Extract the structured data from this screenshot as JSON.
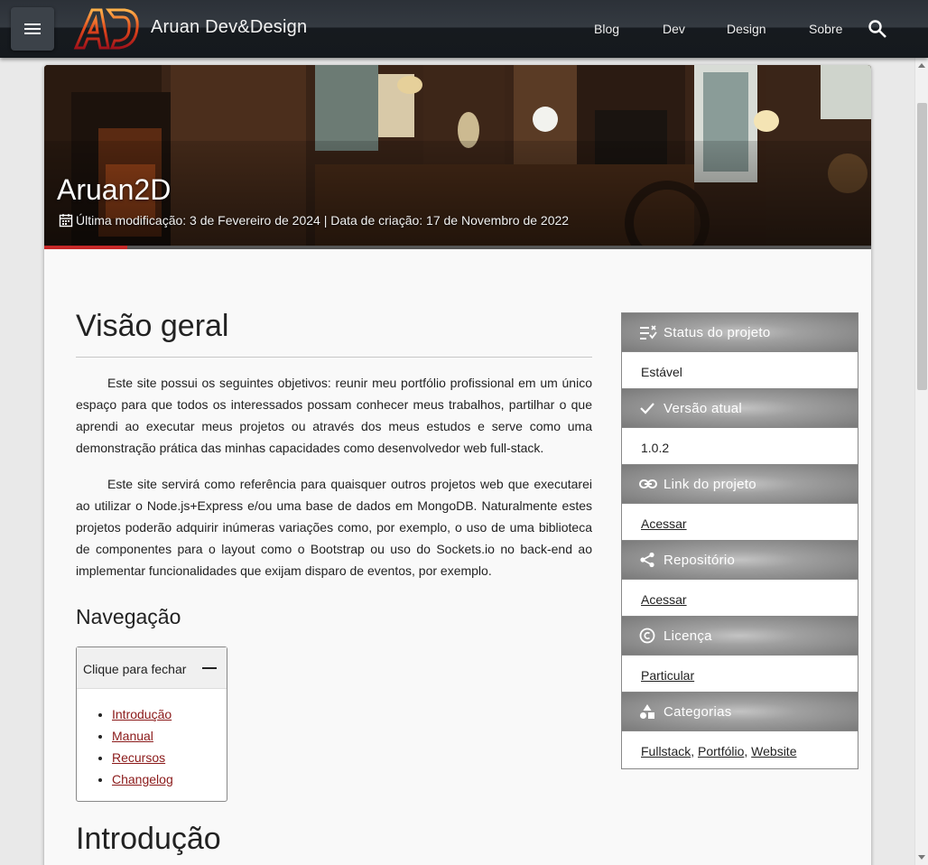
{
  "header": {
    "site_title": "Aruan Dev&Design",
    "logo_text": "AD",
    "nav": [
      "Blog",
      "Dev",
      "Design",
      "Sobre"
    ]
  },
  "hero": {
    "title": "Aruan2D",
    "meta": "Última modificação: 3 de Fevereiro de 2024 | Data de criação: 17 de Novembro de 2022",
    "progress_fraction": 0.1
  },
  "main": {
    "heading": "Visão geral",
    "paragraphs": [
      "Este site possui os seguintes objetivos: reunir meu portfólio profissional em um único espaço para que todos os interessados possam conhecer meus trabalhos, partilhar o que aprendi ao executar meus projetos ou através dos meus estudos e serve como uma demonstração prática das minhas capacidades como desenvolvedor web full-stack.",
      "Este site servirá como referência para quaisquer outros projetos web que executarei ao utilizar o Node.js+Express e/ou uma base de dados em MongoDB. Naturalmente estes projetos poderão adquirir inúmeras variações como, por exemplo, o uso de uma biblioteca de componentes para o layout como o Bootstrap ou uso do Sockets.io no back-end ao implementar funcionalidades que exijam disparo de eventos, por exemplo."
    ],
    "nav_heading": "Navegação",
    "toc_toggle": "Clique para fechar",
    "toc_items": [
      "Introdução",
      "Manual",
      "Recursos",
      "Changelog"
    ],
    "next_heading": "Introdução"
  },
  "sidebar": {
    "sections": [
      {
        "title": "Status do projeto",
        "icon": "checklist-icon",
        "value": "Estável",
        "link": false
      },
      {
        "title": "Versão atual",
        "icon": "check-icon",
        "value": "1.0.2",
        "link": false
      },
      {
        "title": "Link do projeto",
        "icon": "link-icon",
        "value": "Acessar",
        "link": true
      },
      {
        "title": "Repositório",
        "icon": "share-icon",
        "value": "Acessar",
        "link": true
      },
      {
        "title": "Licença",
        "icon": "copyright-icon",
        "value": "Particular",
        "link": true
      },
      {
        "title": "Categorias",
        "icon": "shapes-icon",
        "links": [
          "Fullstack",
          "Portfólio",
          "Website"
        ]
      }
    ]
  },
  "colors": {
    "accent": "#c62828",
    "link": "#8b1a1a",
    "topbar": "#1e2227"
  }
}
